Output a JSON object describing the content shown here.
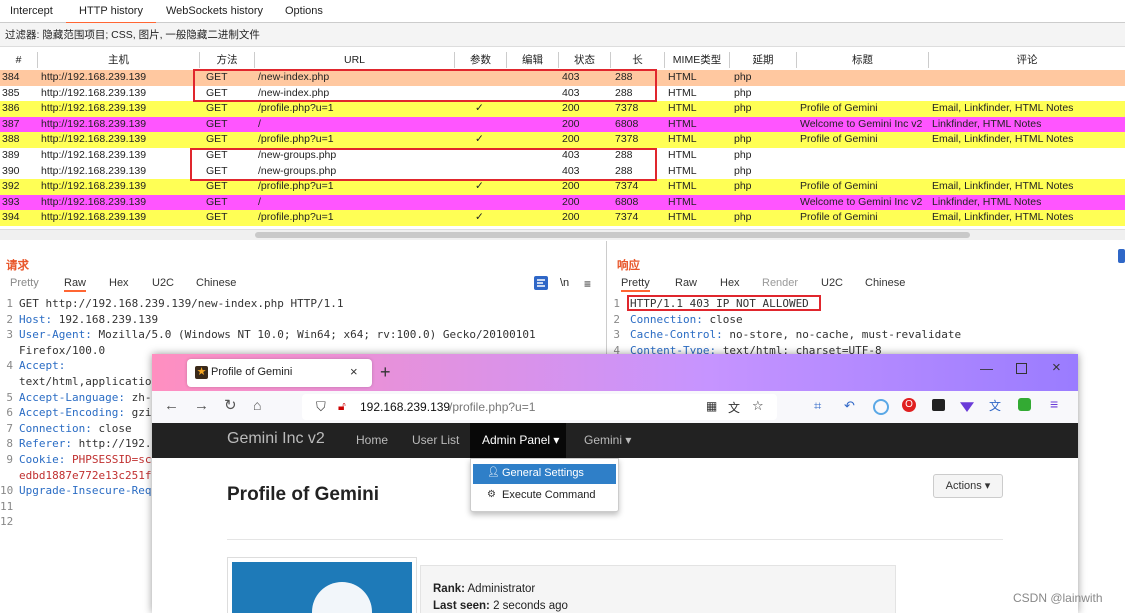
{
  "top_tabs": [
    "Intercept",
    "HTTP history",
    "WebSockets history",
    "Options"
  ],
  "filter_text": "过滤器: 隐藏范围项目; CSS, 图片, 一般隐藏二进制文件",
  "table": {
    "headers": [
      "#",
      "主机",
      "方法",
      "URL",
      "参数",
      "编辑",
      "状态",
      "长",
      "MIME类型",
      "延期",
      "标题",
      "评论"
    ],
    "check_mark": "✓",
    "rows": [
      {
        "id": "384",
        "host": "http://192.168.239.139",
        "method": "GET",
        "url": "/new-index.php",
        "params": false,
        "status": "403",
        "length": "288",
        "mime": "HTML",
        "ext": "php",
        "title": "",
        "comment": "",
        "color": "#ffc8a0"
      },
      {
        "id": "385",
        "host": "http://192.168.239.139",
        "method": "GET",
        "url": "/new-index.php",
        "params": false,
        "status": "403",
        "length": "288",
        "mime": "HTML",
        "ext": "php",
        "title": "",
        "comment": "",
        "color": "#ffffff"
      },
      {
        "id": "386",
        "host": "http://192.168.239.139",
        "method": "GET",
        "url": "/profile.php?u=1",
        "params": true,
        "status": "200",
        "length": "7378",
        "mime": "HTML",
        "ext": "php",
        "title": "Profile of Gemini",
        "comment": "Email, Linkfinder, HTML Notes",
        "color": "#ffff55"
      },
      {
        "id": "387",
        "host": "http://192.168.239.139",
        "method": "GET",
        "url": "/",
        "params": false,
        "status": "200",
        "length": "6808",
        "mime": "HTML",
        "ext": "",
        "title": "Welcome to Gemini Inc v2",
        "comment": "Linkfinder, HTML Notes",
        "color": "#ff55ff"
      },
      {
        "id": "388",
        "host": "http://192.168.239.139",
        "method": "GET",
        "url": "/profile.php?u=1",
        "params": true,
        "status": "200",
        "length": "7378",
        "mime": "HTML",
        "ext": "php",
        "title": "Profile of Gemini",
        "comment": "Email, Linkfinder, HTML Notes",
        "color": "#ffff55"
      },
      {
        "id": "389",
        "host": "http://192.168.239.139",
        "method": "GET",
        "url": "/new-groups.php",
        "params": false,
        "status": "403",
        "length": "288",
        "mime": "HTML",
        "ext": "php",
        "title": "",
        "comment": "",
        "color": "#ffffff"
      },
      {
        "id": "390",
        "host": "http://192.168.239.139",
        "method": "GET",
        "url": "/new-groups.php",
        "params": false,
        "status": "403",
        "length": "288",
        "mime": "HTML",
        "ext": "php",
        "title": "",
        "comment": "",
        "color": "#ffffff"
      },
      {
        "id": "392",
        "host": "http://192.168.239.139",
        "method": "GET",
        "url": "/profile.php?u=1",
        "params": true,
        "status": "200",
        "length": "7374",
        "mime": "HTML",
        "ext": "php",
        "title": "Profile of Gemini",
        "comment": "Email, Linkfinder, HTML Notes",
        "color": "#ffff55"
      },
      {
        "id": "393",
        "host": "http://192.168.239.139",
        "method": "GET",
        "url": "/",
        "params": false,
        "status": "200",
        "length": "6808",
        "mime": "HTML",
        "ext": "",
        "title": "Welcome to Gemini Inc v2",
        "comment": "Linkfinder, HTML Notes",
        "color": "#ff55ff"
      },
      {
        "id": "394",
        "host": "http://192.168.239.139",
        "method": "GET",
        "url": "/profile.php?u=1",
        "params": true,
        "status": "200",
        "length": "7374",
        "mime": "HTML",
        "ext": "php",
        "title": "Profile of Gemini",
        "comment": "Email, Linkfinder, HTML Notes",
        "color": "#ffff55"
      }
    ]
  },
  "request": {
    "title": "请求",
    "tabs": [
      "Pretty",
      "Raw",
      "Hex",
      "U2C",
      "Chinese"
    ],
    "wrap_label": "\\n",
    "lines": [
      {
        "n": "1",
        "key": "",
        "text": "GET http://192.168.239.139/new-index.php HTTP/1.1"
      },
      {
        "n": "2",
        "key": "Host:",
        "text": " 192.168.239.139"
      },
      {
        "n": "3",
        "key": "User-Agent:",
        "text": " Mozilla/5.0 (Windows NT 10.0; Win64; x64; rv:100.0) Gecko/20100101"
      },
      {
        "n": "",
        "key": "",
        "text": "Firefox/100.0"
      },
      {
        "n": "4",
        "key": "Accept:",
        "text": ""
      },
      {
        "n": "",
        "key": "",
        "text": "text/html,applicatio"
      },
      {
        "n": "5",
        "key": "Accept-Language:",
        "text": " zh-"
      },
      {
        "n": "6",
        "key": "Accept-Encoding:",
        "text": " gzi"
      },
      {
        "n": "7",
        "key": "Connection:",
        "text": " close"
      },
      {
        "n": "8",
        "key": "Referer:",
        "text": " http://192."
      },
      {
        "n": "9",
        "key": "Cookie:",
        "text": " PHPSESSID=sc"
      },
      {
        "n": "",
        "key": "",
        "text": "edbd1887e772e13c251f"
      },
      {
        "n": "10",
        "key": "Upgrade-Insecure-Req",
        "text": ""
      },
      {
        "n": "11",
        "key": "",
        "text": ""
      },
      {
        "n": "12",
        "key": "",
        "text": ""
      }
    ]
  },
  "response": {
    "title": "响应",
    "tabs": [
      "Pretty",
      "Raw",
      "Hex",
      "Render",
      "U2C",
      "Chinese"
    ],
    "lines": [
      {
        "n": "1",
        "key": "",
        "text": "HTTP/1.1 403 IP NOT ALLOWED"
      },
      {
        "n": "2",
        "key": "Connection:",
        "text": " close"
      },
      {
        "n": "3",
        "key": "Cache-Control:",
        "text": " no-store, no-cache, must-revalidate"
      },
      {
        "n": "4",
        "key": "Content-Type:",
        "text": " text/html; charset=UTF-8"
      }
    ]
  },
  "browser": {
    "tab_title": "Profile of Gemini",
    "url_host": "192.168.239.139",
    "url_path": "/profile.php?u=1",
    "brand": "Gemini Inc v2",
    "nav": [
      "Home",
      "User List",
      "Admin Panel ▾",
      "Gemini ▾"
    ],
    "dropdown": [
      "General Settings",
      "Execute Command"
    ],
    "page_title": "Profile of Gemini",
    "actions_label": "Actions ▾",
    "rank_label": "Rank:",
    "rank_value": " Administrator",
    "seen_label": "Last seen:",
    "seen_value": " 2 seconds ago"
  },
  "watermark": "CSDN @lainwith"
}
